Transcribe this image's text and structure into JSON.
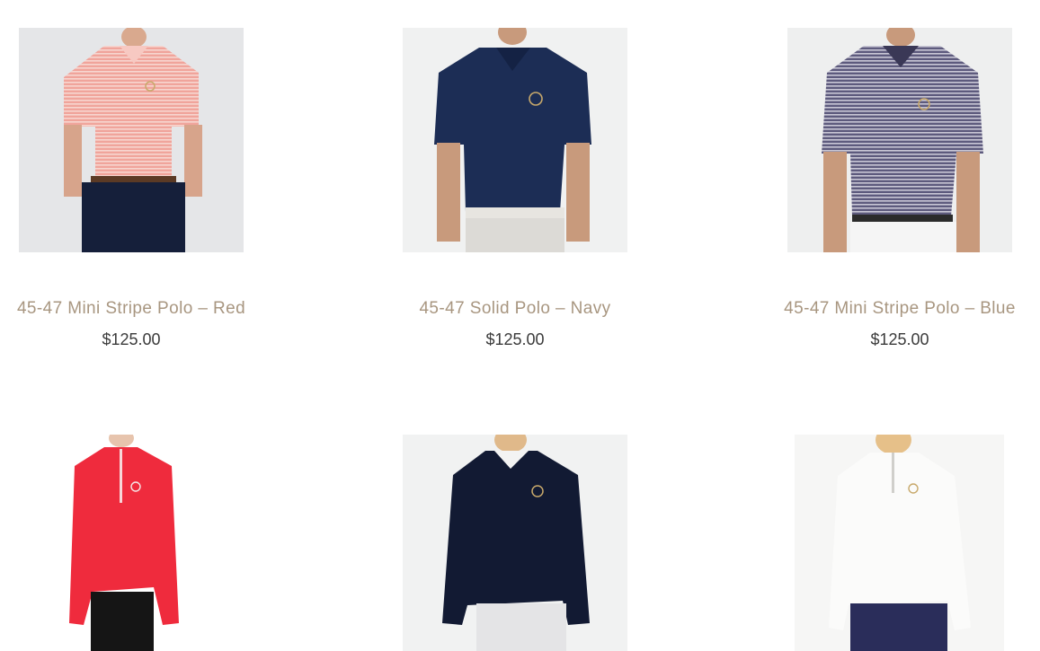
{
  "products": [
    {
      "title": "45-47 Mini Stripe Polo – Red",
      "price": "$125.00",
      "image_icon": "red-striped-polo-photo",
      "color": "#e88c84"
    },
    {
      "title": "45-47 Solid Polo – Navy",
      "price": "$125.00",
      "image_icon": "navy-polo-photo",
      "color": "#1c2d55"
    },
    {
      "title": "45-47 Mini Stripe Polo – Blue",
      "price": "$125.00",
      "image_icon": "blue-striped-polo-photo",
      "color": "#6e6a8a"
    },
    {
      "image_icon": "red-quarter-zip-photo",
      "color": "#ef2b3d"
    },
    {
      "image_icon": "navy-pullover-photo",
      "color": "#121a33"
    },
    {
      "image_icon": "white-quarter-zip-photo",
      "color": "#f3f2ee"
    }
  ]
}
